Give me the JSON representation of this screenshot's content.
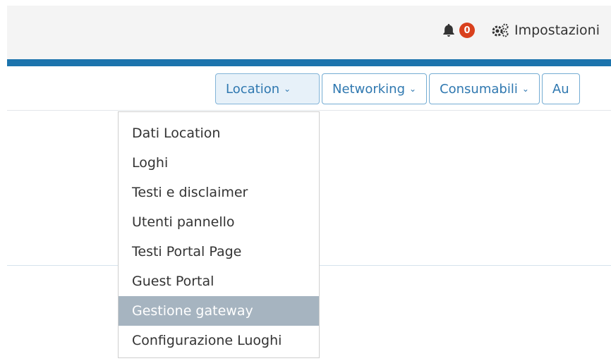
{
  "header": {
    "notifications_count": "0",
    "settings_label": "Impostazioni",
    "icons": [
      "bell-icon",
      "cogs-icon"
    ],
    "accent_color": "#1c74ad",
    "badge_color": "#d9401d"
  },
  "nav": {
    "tabs": [
      {
        "label": "Location"
      },
      {
        "label": "Networking"
      },
      {
        "label": "Consumabili"
      },
      {
        "label": "Au"
      }
    ],
    "chevron": "⌄"
  },
  "dropdown": {
    "items": [
      {
        "label": "Dati Location"
      },
      {
        "label": "Loghi"
      },
      {
        "label": "Testi e disclaimer"
      },
      {
        "label": "Utenti pannello"
      },
      {
        "label": "Testi Portal Page"
      },
      {
        "label": "Guest Portal"
      },
      {
        "label": "Gestione gateway"
      },
      {
        "label": "Configurazione Luoghi"
      }
    ],
    "highlighted": "Gestione gateway"
  }
}
